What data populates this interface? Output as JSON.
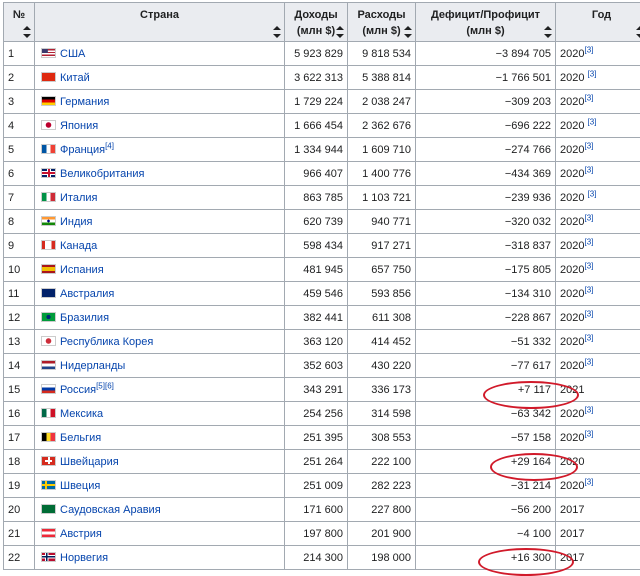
{
  "headers": {
    "idx": "№",
    "country": "Страна",
    "income": [
      "Доходы",
      "(млн $)"
    ],
    "expenses": [
      "Расходы",
      "(млн $)"
    ],
    "balance": [
      "Дефицит/Профицит",
      "(млн $)"
    ],
    "year": "Год"
  },
  "rows": [
    {
      "n": "1",
      "country": "США",
      "flag": "us",
      "ref": "",
      "income": "5 923 829",
      "expenses": "9 818 534",
      "balance": "−3 894 705",
      "year": "2020",
      "yref": "[3]"
    },
    {
      "n": "2",
      "country": "Китай",
      "flag": "cn",
      "ref": "",
      "income": "3 622 313",
      "expenses": "5 388 814",
      "balance": "−1 766 501",
      "year": "2020 ",
      "yref": "[3]"
    },
    {
      "n": "3",
      "country": "Германия",
      "flag": "de",
      "ref": "",
      "income": "1 729 224",
      "expenses": "2 038 247",
      "balance": "−309 203",
      "year": "2020",
      "yref": "[3]"
    },
    {
      "n": "4",
      "country": "Япония",
      "flag": "jp",
      "ref": "",
      "income": "1 666 454",
      "expenses": "2 362 676",
      "balance": "−696 222",
      "year": "2020 ",
      "yref": "[3]"
    },
    {
      "n": "5",
      "country": "Франция",
      "flag": "fr",
      "ref": "[4]",
      "income": "1 334 944",
      "expenses": "1 609 710",
      "balance": "−274 766",
      "year": "2020",
      "yref": "[3]"
    },
    {
      "n": "6",
      "country": "Великобритания",
      "flag": "gb",
      "ref": "",
      "income": "966 407",
      "expenses": "1 400 776",
      "balance": "−434 369",
      "year": "2020",
      "yref": "[3]"
    },
    {
      "n": "7",
      "country": "Италия",
      "flag": "it",
      "ref": "",
      "income": "863 785",
      "expenses": "1 103 721",
      "balance": "−239 936",
      "year": "2020 ",
      "yref": "[3]"
    },
    {
      "n": "8",
      "country": "Индия",
      "flag": "in",
      "ref": "",
      "income": "620 739",
      "expenses": "940 771",
      "balance": "−320 032",
      "year": "2020",
      "yref": "[3]"
    },
    {
      "n": "9",
      "country": "Канада",
      "flag": "ca",
      "ref": "",
      "income": "598 434",
      "expenses": "917 271",
      "balance": "−318 837",
      "year": "2020",
      "yref": "[3]"
    },
    {
      "n": "10",
      "country": "Испания",
      "flag": "es",
      "ref": "",
      "income": "481 945",
      "expenses": "657 750",
      "balance": "−175 805",
      "year": "2020",
      "yref": "[3]"
    },
    {
      "n": "11",
      "country": "Австралия",
      "flag": "au",
      "ref": "",
      "income": "459 546",
      "expenses": "593 856",
      "balance": "−134 310",
      "year": "2020",
      "yref": "[3]"
    },
    {
      "n": "12",
      "country": "Бразилия",
      "flag": "br",
      "ref": "",
      "income": "382 441",
      "expenses": "611 308",
      "balance": "−228 867",
      "year": "2020",
      "yref": "[3]"
    },
    {
      "n": "13",
      "country": "Республика Корея",
      "flag": "kr",
      "ref": "",
      "income": "363 120",
      "expenses": "414 452",
      "balance": "−51 332",
      "year": "2020",
      "yref": "[3]"
    },
    {
      "n": "14",
      "country": "Нидерланды",
      "flag": "nl",
      "ref": "",
      "income": "352 603",
      "expenses": "430 220",
      "balance": "−77 617",
      "year": "2020",
      "yref": "[3]"
    },
    {
      "n": "15",
      "country": "Россия",
      "flag": "ru",
      "ref": "[5][6]",
      "income": "343 291",
      "expenses": "336 173",
      "balance": "+7 117",
      "year": "2021",
      "yref": ""
    },
    {
      "n": "16",
      "country": "Мексика",
      "flag": "mx",
      "ref": "",
      "income": "254 256",
      "expenses": "314 598",
      "balance": "−63 342",
      "year": "2020",
      "yref": "[3]"
    },
    {
      "n": "17",
      "country": "Бельгия",
      "flag": "be",
      "ref": "",
      "income": "251 395",
      "expenses": "308 553",
      "balance": "−57 158",
      "year": "2020",
      "yref": "[3]"
    },
    {
      "n": "18",
      "country": "Швейцария",
      "flag": "ch",
      "ref": "",
      "income": "251 264",
      "expenses": "222 100",
      "balance": "+29 164",
      "year": "2020",
      "yref": ""
    },
    {
      "n": "19",
      "country": "Швеция",
      "flag": "se",
      "ref": "",
      "income": "251 009",
      "expenses": "282 223",
      "balance": "−31 214",
      "year": "2020",
      "yref": "[3]"
    },
    {
      "n": "20",
      "country": "Саудовская Аравия",
      "flag": "sa",
      "ref": "",
      "income": "171 600",
      "expenses": "227 800",
      "balance": "−56 200",
      "year": "2017",
      "yref": ""
    },
    {
      "n": "21",
      "country": "Австрия",
      "flag": "at",
      "ref": "",
      "income": "197 800",
      "expenses": "201 900",
      "balance": "−4 100",
      "year": "2017",
      "yref": ""
    },
    {
      "n": "22",
      "country": "Норвегия",
      "flag": "no",
      "ref": "",
      "income": "214 300",
      "expenses": "198 000",
      "balance": "+16 300",
      "year": "2017",
      "yref": ""
    }
  ],
  "colors": {
    "link": "#0645ad",
    "header_bg": "#eaecf0",
    "border": "#a2a9b1",
    "highlight": "#d11a2a"
  }
}
